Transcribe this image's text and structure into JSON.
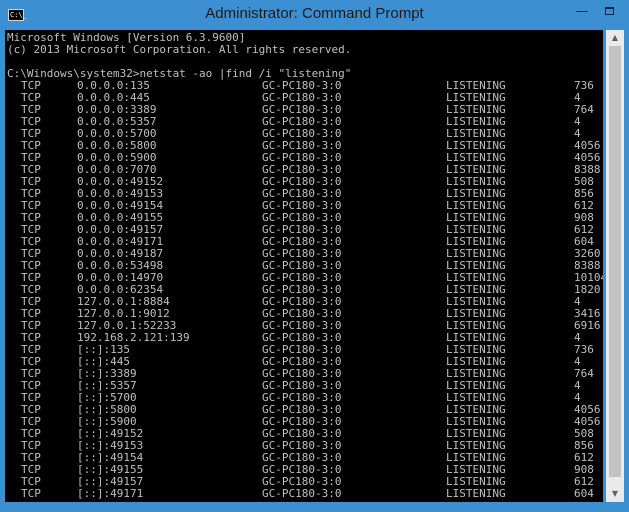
{
  "window": {
    "title": "Administrator: Command Prompt",
    "icon_label": "C:\\_",
    "minimize_glyph": "—"
  },
  "console": {
    "header_lines": [
      "Microsoft Windows [Version 6.3.9600]",
      "(c) 2013 Microsoft Corporation. All rights reserved.",
      "",
      "C:\\Windows\\system32>netstat -ao |find /i \"listening\""
    ],
    "rows": [
      {
        "proto": "TCP",
        "addr": "0.0.0.0:135",
        "host": "GC-PC180-3:0",
        "state": "LISTENING",
        "pid": "736"
      },
      {
        "proto": "TCP",
        "addr": "0.0.0.0:445",
        "host": "GC-PC180-3:0",
        "state": "LISTENING",
        "pid": "4"
      },
      {
        "proto": "TCP",
        "addr": "0.0.0.0:3389",
        "host": "GC-PC180-3:0",
        "state": "LISTENING",
        "pid": "764"
      },
      {
        "proto": "TCP",
        "addr": "0.0.0.0:5357",
        "host": "GC-PC180-3:0",
        "state": "LISTENING",
        "pid": "4"
      },
      {
        "proto": "TCP",
        "addr": "0.0.0.0:5700",
        "host": "GC-PC180-3:0",
        "state": "LISTENING",
        "pid": "4"
      },
      {
        "proto": "TCP",
        "addr": "0.0.0.0:5800",
        "host": "GC-PC180-3:0",
        "state": "LISTENING",
        "pid": "4056"
      },
      {
        "proto": "TCP",
        "addr": "0.0.0.0:5900",
        "host": "GC-PC180-3:0",
        "state": "LISTENING",
        "pid": "4056"
      },
      {
        "proto": "TCP",
        "addr": "0.0.0.0:7070",
        "host": "GC-PC180-3:0",
        "state": "LISTENING",
        "pid": "8388"
      },
      {
        "proto": "TCP",
        "addr": "0.0.0.0:49152",
        "host": "GC-PC180-3:0",
        "state": "LISTENING",
        "pid": "508"
      },
      {
        "proto": "TCP",
        "addr": "0.0.0.0:49153",
        "host": "GC-PC180-3:0",
        "state": "LISTENING",
        "pid": "856"
      },
      {
        "proto": "TCP",
        "addr": "0.0.0.0:49154",
        "host": "GC-PC180-3:0",
        "state": "LISTENING",
        "pid": "612"
      },
      {
        "proto": "TCP",
        "addr": "0.0.0.0:49155",
        "host": "GC-PC180-3:0",
        "state": "LISTENING",
        "pid": "908"
      },
      {
        "proto": "TCP",
        "addr": "0.0.0.0:49157",
        "host": "GC-PC180-3:0",
        "state": "LISTENING",
        "pid": "612"
      },
      {
        "proto": "TCP",
        "addr": "0.0.0.0:49171",
        "host": "GC-PC180-3:0",
        "state": "LISTENING",
        "pid": "604"
      },
      {
        "proto": "TCP",
        "addr": "0.0.0.0:49187",
        "host": "GC-PC180-3:0",
        "state": "LISTENING",
        "pid": "3260"
      },
      {
        "proto": "TCP",
        "addr": "0.0.0.0:53498",
        "host": "GC-PC180-3:0",
        "state": "LISTENING",
        "pid": "8388"
      },
      {
        "proto": "TCP",
        "addr": "0.0.0.0:14970",
        "host": "GC-PC180-3:0",
        "state": "LISTENING",
        "pid": "10104"
      },
      {
        "proto": "TCP",
        "addr": "0.0.0.0:62354",
        "host": "GC-PC180-3:0",
        "state": "LISTENING",
        "pid": "1820"
      },
      {
        "proto": "TCP",
        "addr": "127.0.0.1:8884",
        "host": "GC-PC180-3:0",
        "state": "LISTENING",
        "pid": "4"
      },
      {
        "proto": "TCP",
        "addr": "127.0.0.1:9012",
        "host": "GC-PC180-3:0",
        "state": "LISTENING",
        "pid": "3416"
      },
      {
        "proto": "TCP",
        "addr": "127.0.0.1:52233",
        "host": "GC-PC180-3:0",
        "state": "LISTENING",
        "pid": "6916"
      },
      {
        "proto": "TCP",
        "addr": "192.168.2.121:139",
        "host": "GC-PC180-3:0",
        "state": "LISTENING",
        "pid": "4"
      },
      {
        "proto": "TCP",
        "addr": "[::]:135",
        "host": "GC-PC180-3:0",
        "state": "LISTENING",
        "pid": "736"
      },
      {
        "proto": "TCP",
        "addr": "[::]:445",
        "host": "GC-PC180-3:0",
        "state": "LISTENING",
        "pid": "4"
      },
      {
        "proto": "TCP",
        "addr": "[::]:3389",
        "host": "GC-PC180-3:0",
        "state": "LISTENING",
        "pid": "764"
      },
      {
        "proto": "TCP",
        "addr": "[::]:5357",
        "host": "GC-PC180-3:0",
        "state": "LISTENING",
        "pid": "4"
      },
      {
        "proto": "TCP",
        "addr": "[::]:5700",
        "host": "GC-PC180-3:0",
        "state": "LISTENING",
        "pid": "4"
      },
      {
        "proto": "TCP",
        "addr": "[::]:5800",
        "host": "GC-PC180-3:0",
        "state": "LISTENING",
        "pid": "4056"
      },
      {
        "proto": "TCP",
        "addr": "[::]:5900",
        "host": "GC-PC180-3:0",
        "state": "LISTENING",
        "pid": "4056"
      },
      {
        "proto": "TCP",
        "addr": "[::]:49152",
        "host": "GC-PC180-3:0",
        "state": "LISTENING",
        "pid": "508"
      },
      {
        "proto": "TCP",
        "addr": "[::]:49153",
        "host": "GC-PC180-3:0",
        "state": "LISTENING",
        "pid": "856"
      },
      {
        "proto": "TCP",
        "addr": "[::]:49154",
        "host": "GC-PC180-3:0",
        "state": "LISTENING",
        "pid": "612"
      },
      {
        "proto": "TCP",
        "addr": "[::]:49155",
        "host": "GC-PC180-3:0",
        "state": "LISTENING",
        "pid": "908"
      },
      {
        "proto": "TCP",
        "addr": "[::]:49157",
        "host": "GC-PC180-3:0",
        "state": "LISTENING",
        "pid": "612"
      },
      {
        "proto": "TCP",
        "addr": "[::]:49171",
        "host": "GC-PC180-3:0",
        "state": "LISTENING",
        "pid": "604"
      }
    ]
  },
  "scrollbar": {
    "up_glyph": "▲",
    "down_glyph": "▼",
    "thumb_fraction": 0.98
  },
  "colors": {
    "frame": "#3c8fd1",
    "console_bg": "#000000",
    "console_fg": "#c0c0c0"
  }
}
